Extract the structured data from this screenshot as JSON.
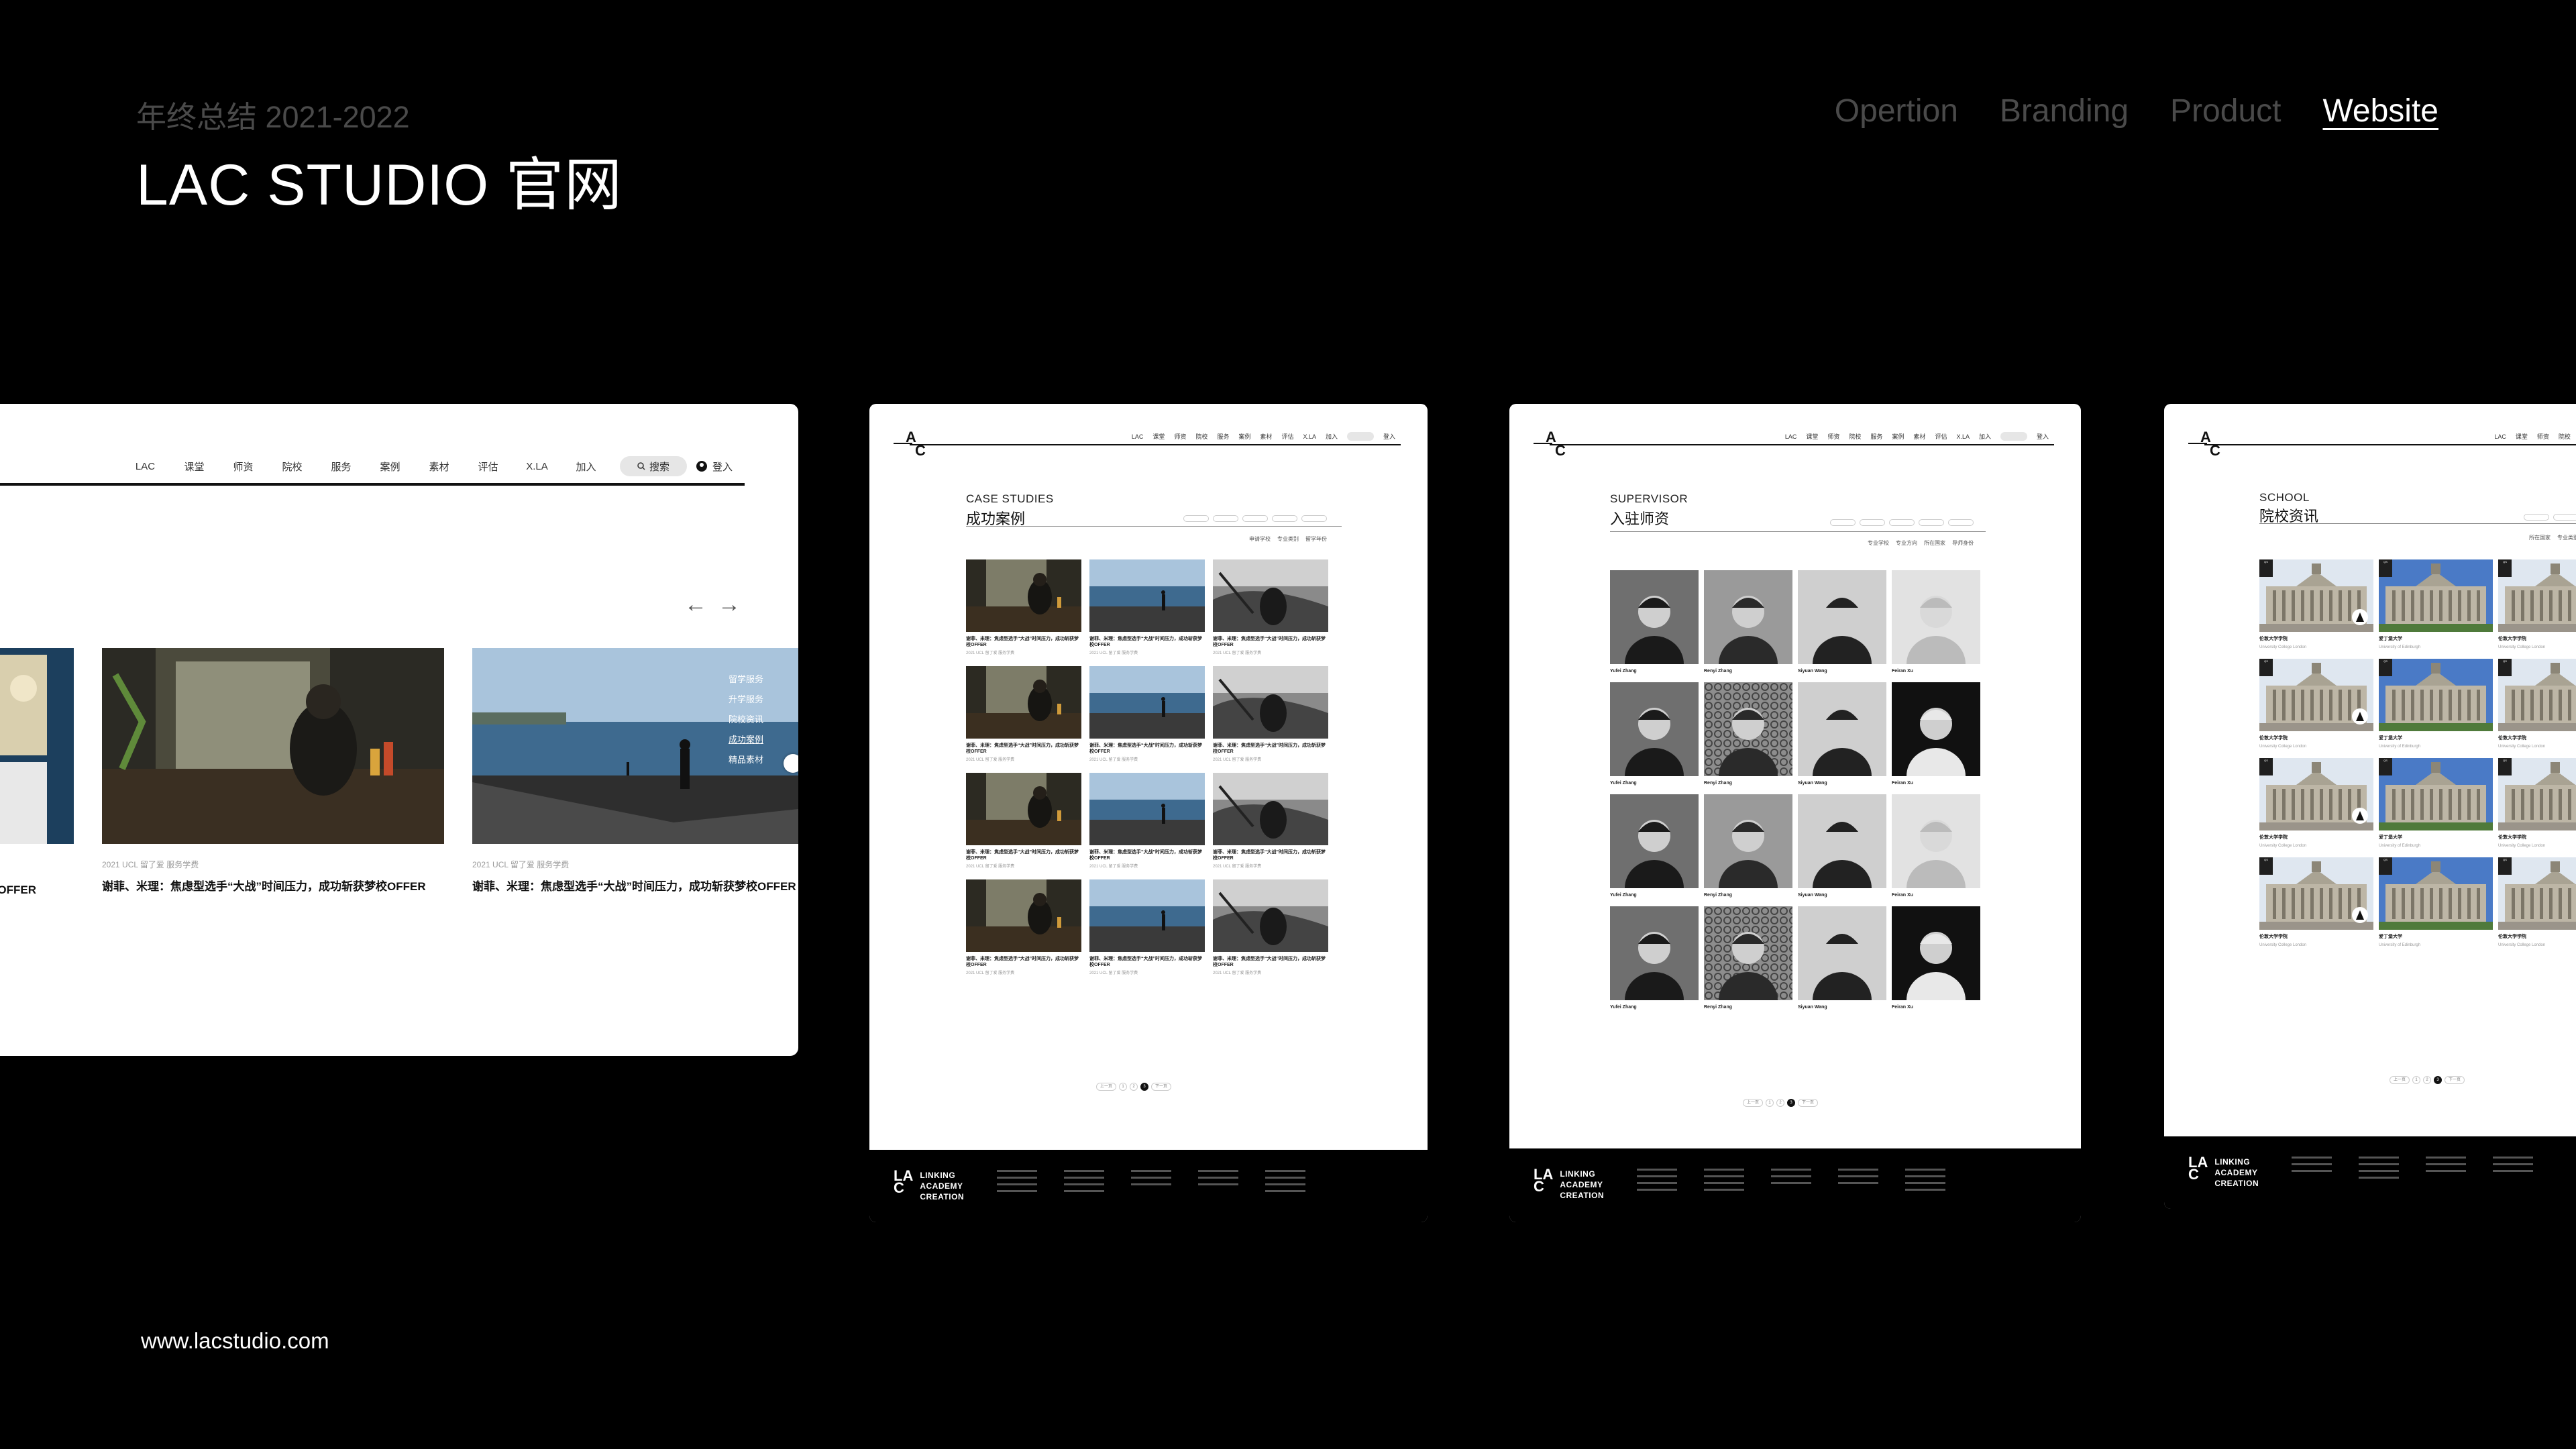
{
  "header": {
    "subtitle": "年终总结 2021-2022",
    "title": "LAC STUDIO 官网"
  },
  "topnav": [
    {
      "label": "Opertion",
      "active": false
    },
    {
      "label": "Branding",
      "active": false
    },
    {
      "label": "Product",
      "active": false
    },
    {
      "label": "Website",
      "active": true
    }
  ],
  "footer_url": "www.lacstudio.com",
  "screen1": {
    "menu": [
      "LAC",
      "课堂",
      "师资",
      "院校",
      "服务",
      "案例",
      "素材",
      "评估",
      "X.LA",
      "加入"
    ],
    "search_label": "搜索",
    "login_label": "登入",
    "arrow_prev": "←",
    "arrow_next": "→",
    "cards": [
      {
        "meta": "2021  UCL  留了爱  服务学费",
        "caption": "谢菲、米理：焦虑型选手“大战”时间压力，成功斩获梦校OFFER"
      },
      {
        "meta": "2021  UCL  留了爱  服务学费",
        "caption": "谢菲、米理：焦虑型选手“大战”时间压力，成功斩获梦校OFFER"
      }
    ],
    "left_caption_tail": "梦校OFFER",
    "dropdown": [
      {
        "label": "留学服务",
        "selected": false
      },
      {
        "label": "升学服务",
        "selected": false
      },
      {
        "label": "院校资讯",
        "selected": false
      },
      {
        "label": "成功案例",
        "selected": true
      },
      {
        "label": "精品素材",
        "selected": false
      }
    ]
  },
  "screen2": {
    "section_en": "CASE STUDIES",
    "section_cn": "成功案例",
    "filters": [
      "申请学校",
      "专业类别",
      "留学年份"
    ],
    "item_title": "谢菲、米理：焦虑型选手“大战”时间压力，成功斩获梦校OFFER",
    "item_meta": "2021  UCL  留了爱  服务学费",
    "pager": [
      "上一页",
      "1",
      "2",
      "3",
      "下一页"
    ]
  },
  "screen3": {
    "section_en": "SUPERVISOR",
    "section_cn": "入驻师资",
    "filters": [
      "专业学校",
      "专业方向",
      "所在国家",
      "导师身份"
    ],
    "people": [
      "Yufei Zhang",
      "Renyi Zhang",
      "Siyuan Wang",
      "Feiran Xu"
    ],
    "pager": [
      "上一页",
      "1",
      "2",
      "3",
      "下一页"
    ]
  },
  "screen4": {
    "section_en": "SCHOOL",
    "section_cn": "院校资讯",
    "filters": [
      "所在国家",
      "专业类别"
    ],
    "schools": [
      {
        "cn": "伦敦大学学院",
        "en": "University College London",
        "rank": "QS"
      },
      {
        "cn": "爱丁堡大学",
        "en": "University of Edinburgh",
        "rank": "QS"
      },
      {
        "cn": "伦敦大学学院",
        "en": "University College London",
        "rank": "QS"
      }
    ],
    "pager": [
      "上一页",
      "1",
      "2",
      "3",
      "下一页"
    ]
  },
  "page_footer": {
    "mark_top": "LA",
    "mark_bottom": "C",
    "words": [
      "LINKING",
      "ACADEMY",
      "CREATION"
    ]
  }
}
